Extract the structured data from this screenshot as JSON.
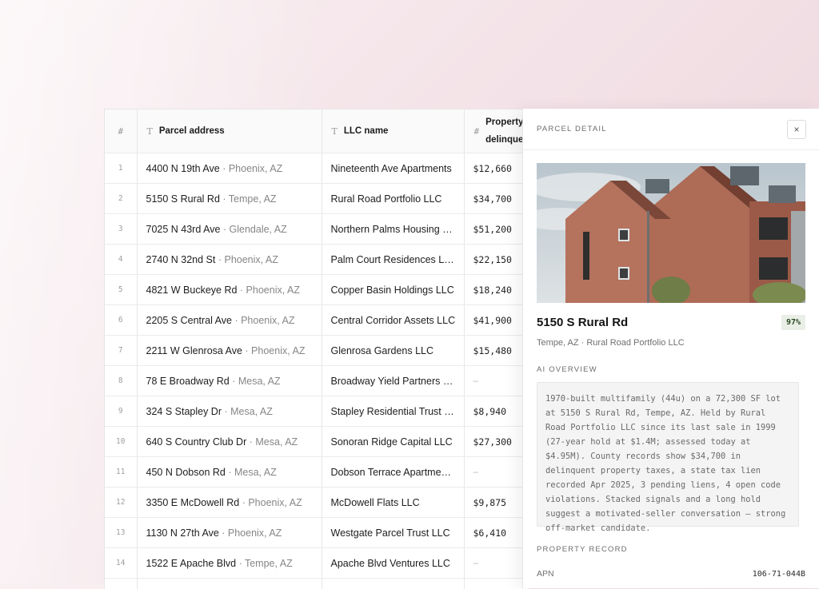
{
  "table": {
    "columns": {
      "index": "#",
      "address": {
        "icon": "text-type-icon",
        "label": "Parcel address"
      },
      "llc": {
        "icon": "text-type-icon",
        "label": "LLC name"
      },
      "tax": {
        "icon": "number-type-icon",
        "label_line1": "Property",
        "label_line2": "delinque"
      }
    },
    "rows": [
      {
        "idx": "1",
        "street": "4400 N 19th Ave",
        "city": " · Phoenix, AZ",
        "llc": "Nineteenth Ave Apartments",
        "tax": "$12,660"
      },
      {
        "idx": "2",
        "street": "5150 S Rural Rd",
        "city": " · Tempe, AZ",
        "llc": "Rural Road Portfolio LLC",
        "tax": "$34,700"
      },
      {
        "idx": "3",
        "street": "7025 N 43rd Ave",
        "city": " · Glendale, AZ",
        "llc": "Northern Palms Housing LLC",
        "tax": "$51,200"
      },
      {
        "idx": "4",
        "street": "2740 N 32nd St",
        "city": " · Phoenix, AZ",
        "llc": "Palm Court Residences LLC",
        "tax": "$22,150"
      },
      {
        "idx": "5",
        "street": "4821 W Buckeye Rd",
        "city": " · Phoenix, AZ",
        "llc": "Copper Basin Holdings LLC",
        "tax": "$18,240"
      },
      {
        "idx": "6",
        "street": "2205 S Central Ave",
        "city": " · Phoenix, AZ",
        "llc": "Central Corridor Assets LLC",
        "tax": "$41,900"
      },
      {
        "idx": "7",
        "street": "2211 W Glenrosa Ave",
        "city": " · Phoenix, AZ",
        "llc": "Glenrosa Gardens LLC",
        "tax": "$15,480"
      },
      {
        "idx": "8",
        "street": "78 E Broadway Rd",
        "city": " · Mesa, AZ",
        "llc": "Broadway Yield Partners LLC",
        "tax": "–"
      },
      {
        "idx": "9",
        "street": "324 S Stapley Dr",
        "city": " · Mesa, AZ",
        "llc": "Stapley Residential Trust LLC",
        "tax": "$8,940"
      },
      {
        "idx": "10",
        "street": "640 S Country Club Dr",
        "city": " · Mesa, AZ",
        "llc": "Sonoran Ridge Capital LLC",
        "tax": "$27,300"
      },
      {
        "idx": "11",
        "street": "450 N Dobson Rd",
        "city": " · Mesa, AZ",
        "llc": "Dobson Terrace Apartments LLC",
        "tax": "–"
      },
      {
        "idx": "12",
        "street": "3350 E McDowell Rd",
        "city": " · Phoenix, AZ",
        "llc": "McDowell Flats LLC",
        "tax": "$9,875"
      },
      {
        "idx": "13",
        "street": "1130 N 27th Ave",
        "city": " · Phoenix, AZ",
        "llc": "Westgate Parcel Trust LLC",
        "tax": "$6,410"
      },
      {
        "idx": "14",
        "street": "1522 E Apache Blvd",
        "city": " · Tempe, AZ",
        "llc": "Apache Blvd Ventures LLC",
        "tax": "–"
      },
      {
        "idx": "",
        "street": "",
        "city": "",
        "llc": "",
        "tax": ""
      }
    ]
  },
  "detail": {
    "eyebrow": "PARCEL DETAIL",
    "close_icon": "×",
    "photo_alt": "brick-apartment-building-photo",
    "title": "5150 S Rural Rd",
    "score": "97%",
    "subtitle": "Tempe, AZ · Rural Road Portfolio LLC",
    "ai_label": "AI OVERVIEW",
    "ai_text": "1970-built multifamily (44u) on a 72,300 SF lot at 5150 S Rural Rd, Tempe, AZ. Held by Rural Road Portfolio LLC since its last sale in 1999 (27-year hold at $1.4M; assessed today at $4.95M). County records show $34,700 in delinquent property taxes, a state tax lien recorded Apr 2025, 3 pending liens, 4 open code violations. Stacked signals and a long hold suggest a motivated-seller conversation — strong off-market candidate.",
    "record_label": "PROPERTY RECORD",
    "record": {
      "key": "APN",
      "value": "106-71-044B"
    }
  },
  "colors": {
    "accent_badge_bg": "#e9efe6",
    "background_tint": "#f3e2e7"
  }
}
